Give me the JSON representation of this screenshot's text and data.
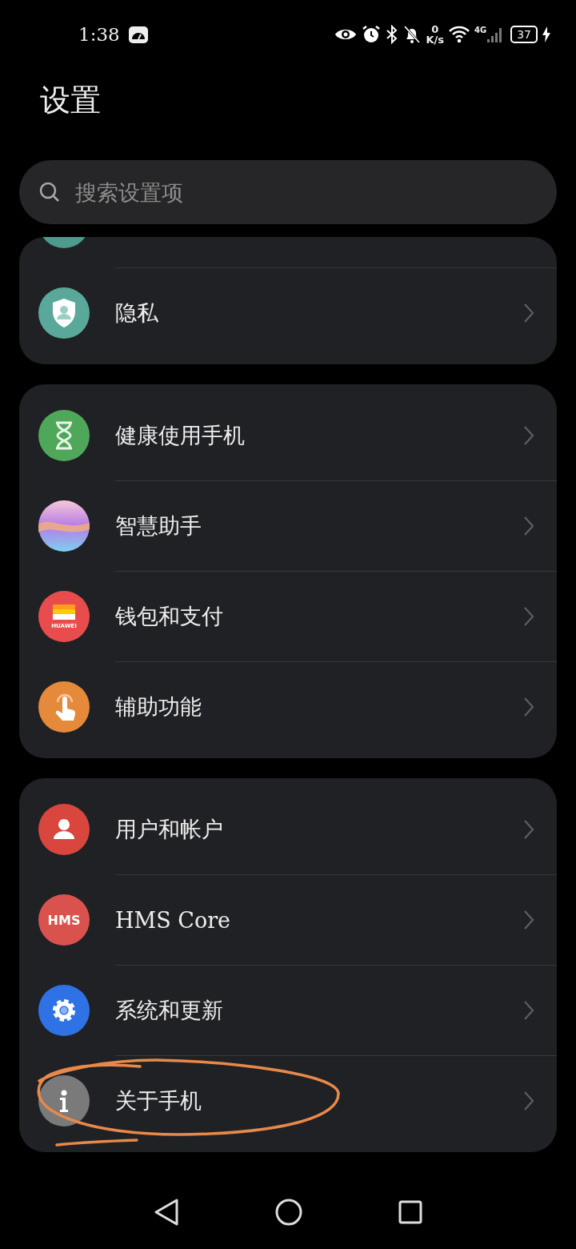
{
  "status_bar": {
    "time": "1:38",
    "speed_value": "0",
    "speed_unit": "K/s",
    "network": "4G",
    "battery": "37"
  },
  "title": "设置",
  "search": {
    "placeholder": "搜索设置项"
  },
  "groups": [
    {
      "partial_top": true,
      "rows": [
        {
          "kind": "shield",
          "label": "隐私"
        }
      ]
    },
    {
      "partial_top": false,
      "rows": [
        {
          "kind": "hourglass",
          "label": "健康使用手机"
        },
        {
          "kind": "orb",
          "label": "智慧助手"
        },
        {
          "kind": "wallet",
          "label": "钱包和支付",
          "icon_text": "HUAWEI"
        },
        {
          "kind": "touch",
          "label": "辅助功能"
        }
      ]
    },
    {
      "partial_top": false,
      "rows": [
        {
          "kind": "user",
          "label": "用户和帐户"
        },
        {
          "kind": "hms",
          "label": "HMS Core",
          "icon_text": "HMS"
        },
        {
          "kind": "gear",
          "label": "系统和更新"
        },
        {
          "kind": "info",
          "label": "关于手机"
        }
      ]
    }
  ]
}
